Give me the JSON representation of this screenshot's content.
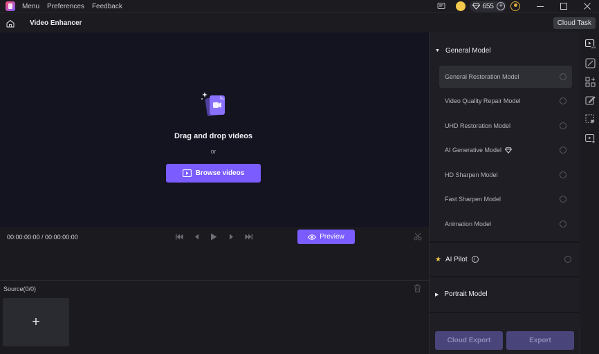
{
  "titlebar": {
    "menu": [
      "Menu",
      "Preferences",
      "Feedback"
    ],
    "credits": "655",
    "icons": [
      "app-logo",
      "message-icon",
      "coin-icon",
      "diamond-icon",
      "plus-icon",
      "avatar-icon"
    ],
    "window_controls": [
      "minimize",
      "maximize",
      "close"
    ]
  },
  "header": {
    "title": "Video Enhancer",
    "cloud_task_label": "Cloud Task",
    "home_icon": "home-icon"
  },
  "preview": {
    "drop_title": "Drag and drop videos",
    "or_text": "or",
    "browse_label": "Browse videos",
    "drop_icon": "video-file-icon"
  },
  "controls": {
    "timecode": "00:00:00:00 / 00:00:00:00",
    "preview_label": "Preview",
    "icons": [
      "skip-back-icon",
      "step-back-icon",
      "play-icon",
      "step-forward-icon",
      "skip-forward-icon",
      "scissors-icon"
    ]
  },
  "source": {
    "label": "Source(0/0)",
    "add_symbol": "+"
  },
  "panel": {
    "general_section": "General Model",
    "models": [
      {
        "label": "General Restoration Model",
        "selected": true
      },
      {
        "label": "Video Quality Repair Model",
        "selected": false
      },
      {
        "label": "UHD Restoration Model",
        "selected": false
      },
      {
        "label": "AI Generative Model",
        "selected": false,
        "premium": true
      },
      {
        "label": "HD Sharpen Model",
        "selected": false
      },
      {
        "label": "Fast Sharpen Model",
        "selected": false
      },
      {
        "label": "Animation Model",
        "selected": false
      }
    ],
    "ai_pilot": "AI Pilot",
    "portrait_section": "Portrait Model",
    "cloud_export": "Cloud Export",
    "export": "Export"
  },
  "rail": {
    "icons": [
      "uhd-video-icon",
      "edit-curve-icon",
      "grid-add-icon",
      "edit-pen-icon",
      "selection-icon",
      "video-add-icon"
    ]
  },
  "colors": {
    "accent": "#7a5cff",
    "disabled_button": "#49457a",
    "panel_bg": "#1e1e24",
    "canvas_bg": "#141320"
  }
}
